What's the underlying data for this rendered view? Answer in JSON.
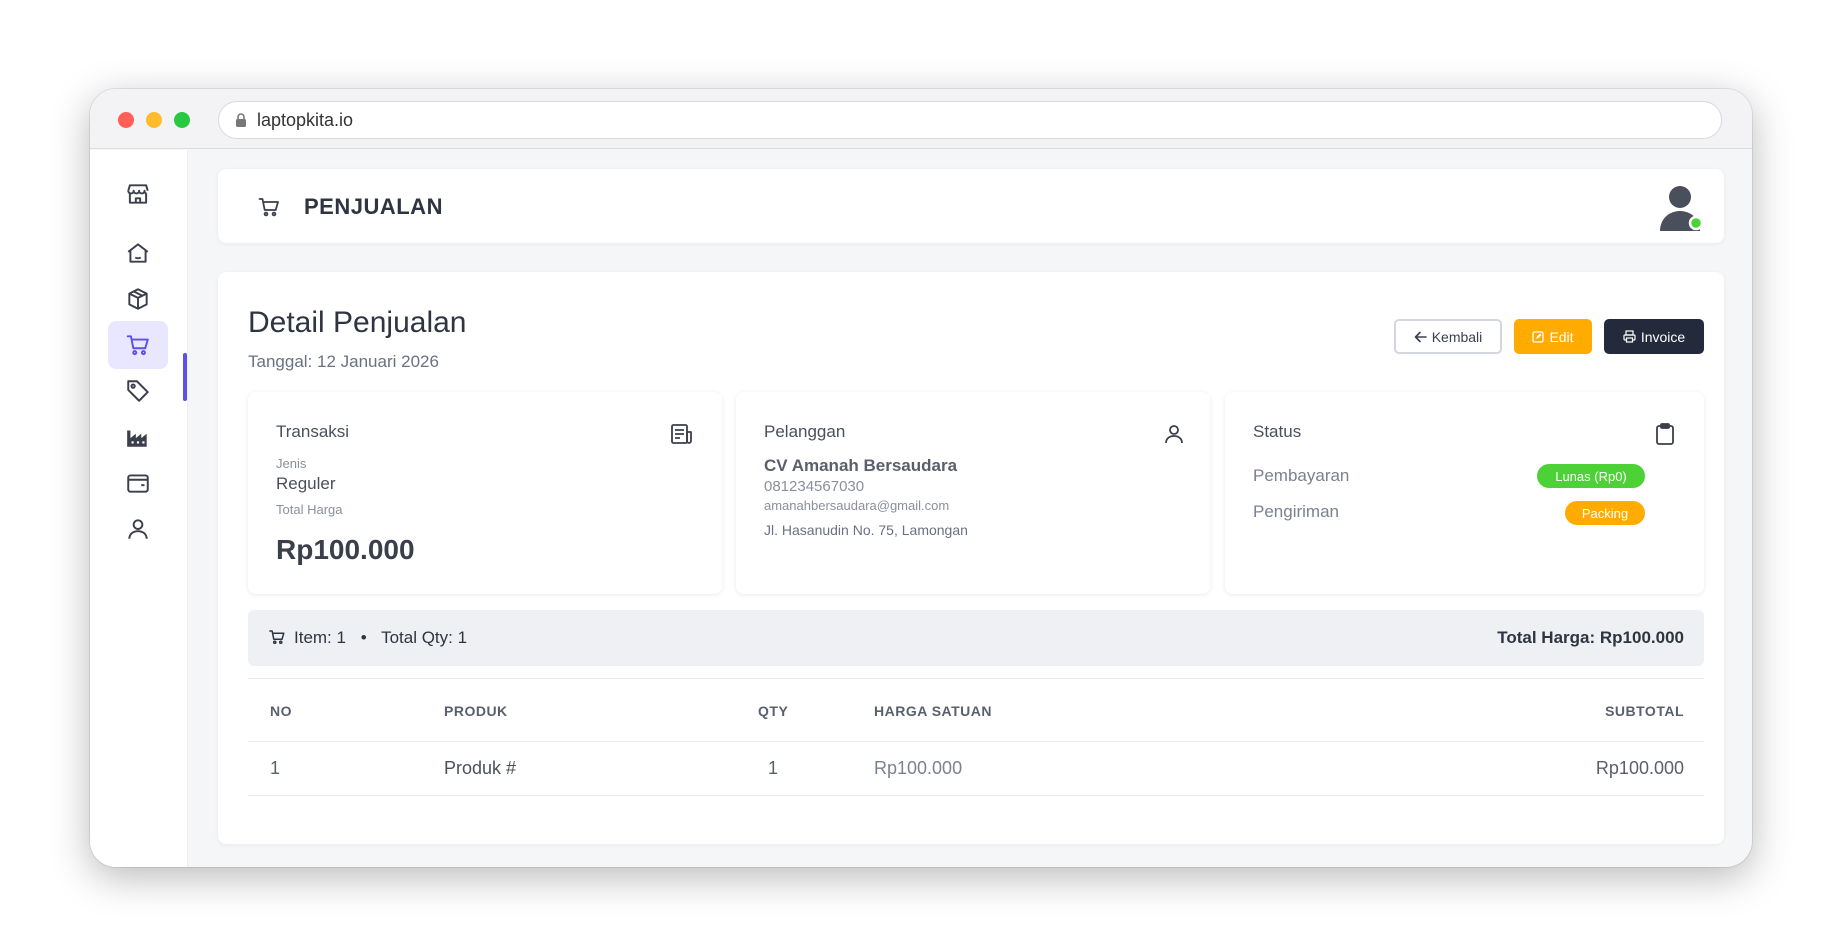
{
  "browser": {
    "url": "laptopkita.io"
  },
  "sidebar": {
    "items": [
      {
        "icon": "store-icon"
      },
      {
        "icon": "home-icon"
      },
      {
        "icon": "box-icon"
      },
      {
        "icon": "cart-icon",
        "active": true
      },
      {
        "icon": "tag-icon"
      },
      {
        "icon": "factory-icon"
      },
      {
        "icon": "wallet-icon"
      },
      {
        "icon": "user-icon"
      }
    ]
  },
  "header": {
    "title": "PENJUALAN",
    "icon": "cart-icon",
    "status_color": "#4cd137"
  },
  "page": {
    "title": "Detail Penjualan",
    "date": "Tanggal: 12 Januari 2026",
    "buttons": {
      "back": "Kembali",
      "edit": "Edit",
      "invoice": "Invoice"
    }
  },
  "transaksi": {
    "title": "Transaksi",
    "jenis_label": "Jenis",
    "jenis_value": "Reguler",
    "total_label": "Total Harga",
    "total_value": "Rp100.000"
  },
  "pelanggan": {
    "title": "Pelanggan",
    "name": "CV Amanah Bersaudara",
    "phone": "081234567030",
    "email": "amanahbersaudara@gmail.com",
    "address": "Jl. Hasanudin No. 75, Lamongan"
  },
  "status": {
    "title": "Status",
    "payment_label": "Pembayaran",
    "payment_value": "Lunas (Rp0)",
    "shipping_label": "Pengiriman",
    "shipping_value": "Packing",
    "colors": {
      "paid": "#4cd137",
      "packing": "#ffab00"
    }
  },
  "summary": {
    "items": "Item: 1",
    "separator": "•",
    "qty": "Total Qty: 1",
    "total": "Total Harga: Rp100.000"
  },
  "table": {
    "headers": [
      "NO",
      "PRODUK",
      "QTY",
      "HARGA SATUAN",
      "SUBTOTAL"
    ],
    "rows": [
      [
        "1",
        "Produk #",
        "1",
        "Rp100.000",
        "Rp100.000"
      ]
    ]
  }
}
